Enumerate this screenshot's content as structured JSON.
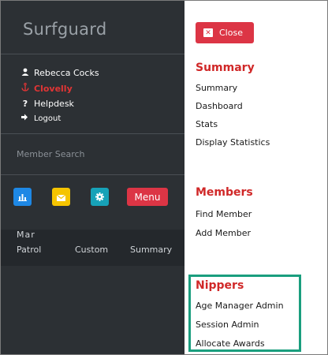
{
  "sidebar": {
    "brand": "Surfguard",
    "user_name": "Rebecca Cocks",
    "club": "Clovelly",
    "helpdesk": "Helpdesk",
    "logout": "Logout",
    "search_placeholder": "Member Search",
    "menu_button": "Menu",
    "tabs_peek": "Mar",
    "tabs": [
      "Patrol",
      "Custom",
      "Summary"
    ]
  },
  "close_label": "Close",
  "sections": [
    {
      "heading": "Summary",
      "items": [
        "Summary",
        "Dashboard",
        "Stats",
        "Display Statistics"
      ]
    },
    {
      "heading": "Members",
      "items": [
        "Find Member",
        "Add Member"
      ]
    },
    {
      "heading": "Nippers",
      "items": [
        "Age Manager Admin",
        "Session Admin",
        "Allocate Awards"
      ]
    }
  ],
  "colors": {
    "sidebar_bg": "#2c3034",
    "accent_red": "#dc3545",
    "highlight": "#1a9e7e"
  }
}
